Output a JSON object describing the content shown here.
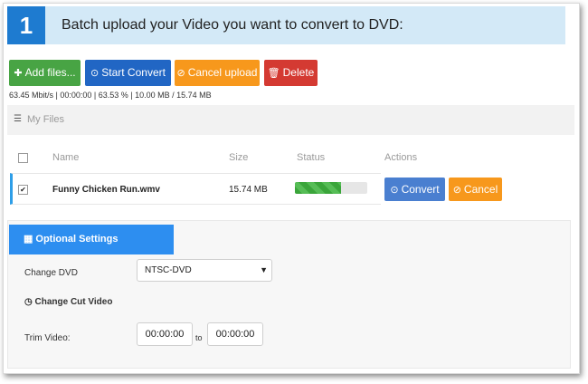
{
  "step": {
    "number": "1",
    "title": "Batch upload your Video you want to convert to DVD:"
  },
  "toolbar": {
    "add_label": "Add files...",
    "start_label": "Start Convert",
    "cancel_label": "Cancel upload",
    "delete_label": "Delete"
  },
  "stats": "63.45 Mbit/s | 00:00:00 | 63.53 % | 10.00 MB / 15.74 MB",
  "my_files": {
    "label": "My Files"
  },
  "table": {
    "headers": {
      "name": "Name",
      "size": "Size",
      "status": "Status",
      "actions": "Actions"
    },
    "rows": [
      {
        "name": "Funny Chicken Run.wmv",
        "size": "15.74 MB",
        "checked": true,
        "progress": 0.6353,
        "convert_label": "Convert",
        "cancel_label": "Cancel"
      }
    ]
  },
  "optional": {
    "tab_label": "Optional Settings",
    "change_dvd_label": "Change DVD",
    "dvd_selected": "NTSC-DVD",
    "cut_title": "Change Cut Video",
    "trim_label": "Trim Video:",
    "trim_from": "00:00:00",
    "trim_to": "00:00:00",
    "to_label": "to"
  },
  "colors": {
    "accent": "#1e7bd0",
    "green": "#48a444",
    "orange": "#f7981c",
    "red": "#d43a32",
    "tab": "#2d8ef0"
  },
  "icons": [
    "plus-icon",
    "upload-circle-icon",
    "cancel-circle-icon",
    "trash-icon",
    "list-icon",
    "grid-icon",
    "clock-icon",
    "chevron-down-icon"
  ]
}
